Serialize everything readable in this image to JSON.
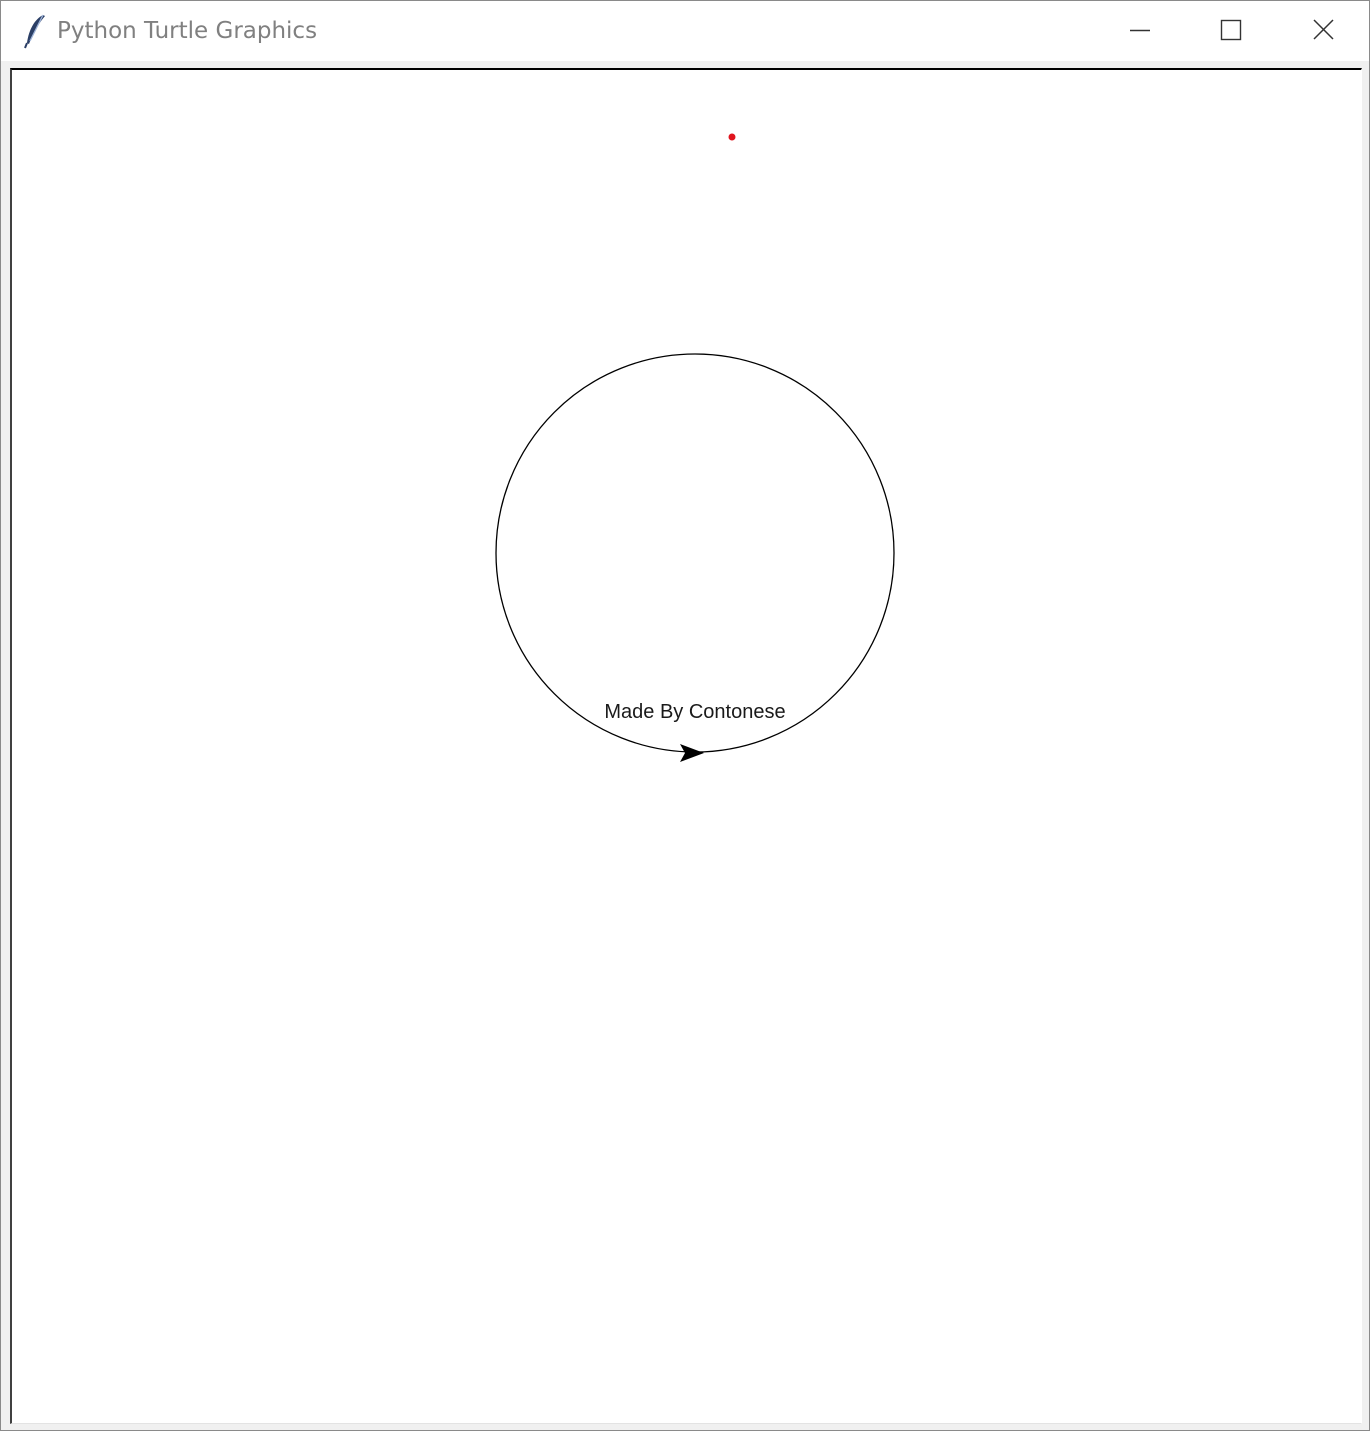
{
  "window": {
    "title": "Python Turtle Graphics",
    "app_icon": "feather-icon",
    "controls": {
      "minimize_icon": "minimize-icon",
      "maximize_icon": "maximize-icon",
      "close_icon": "close-icon"
    }
  },
  "canvas": {
    "background_color": "#ffffff",
    "caption": "Made By Contonese",
    "circle_color": "#000000",
    "dot_color": "#e0141e",
    "turtle_shape": "classic-arrow",
    "turtle_heading": "east"
  }
}
